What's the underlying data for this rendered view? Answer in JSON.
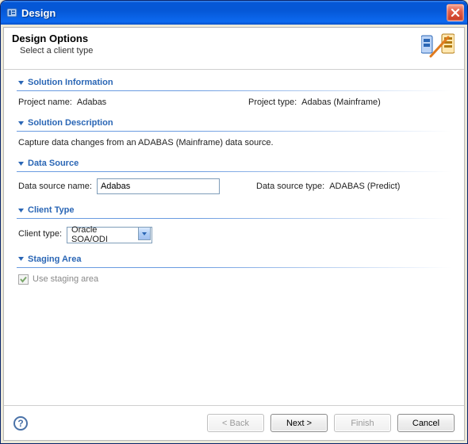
{
  "window": {
    "title": "Design"
  },
  "header": {
    "title": "Design Options",
    "subtitle": "Select a client type"
  },
  "sections": {
    "solution_info": {
      "title": "Solution Information",
      "project_name_label": "Project name:",
      "project_name_value": "Adabas",
      "project_type_label": "Project type:",
      "project_type_value": "Adabas (Mainframe)"
    },
    "solution_desc": {
      "title": "Solution Description",
      "text": "Capture data changes from an ADABAS (Mainframe) data source."
    },
    "data_source": {
      "title": "Data Source",
      "name_label": "Data source name:",
      "name_value": "Adabas",
      "type_label": "Data source type:",
      "type_value": "ADABAS (Predict)"
    },
    "client_type": {
      "title": "Client Type",
      "label": "Client type:",
      "selected": "Oracle SOA/ODI"
    },
    "staging_area": {
      "title": "Staging Area",
      "checkbox_label": "Use staging area",
      "checked": true,
      "enabled": false
    }
  },
  "footer": {
    "back": "< Back",
    "next": "Next >",
    "finish": "Finish",
    "cancel": "Cancel"
  }
}
